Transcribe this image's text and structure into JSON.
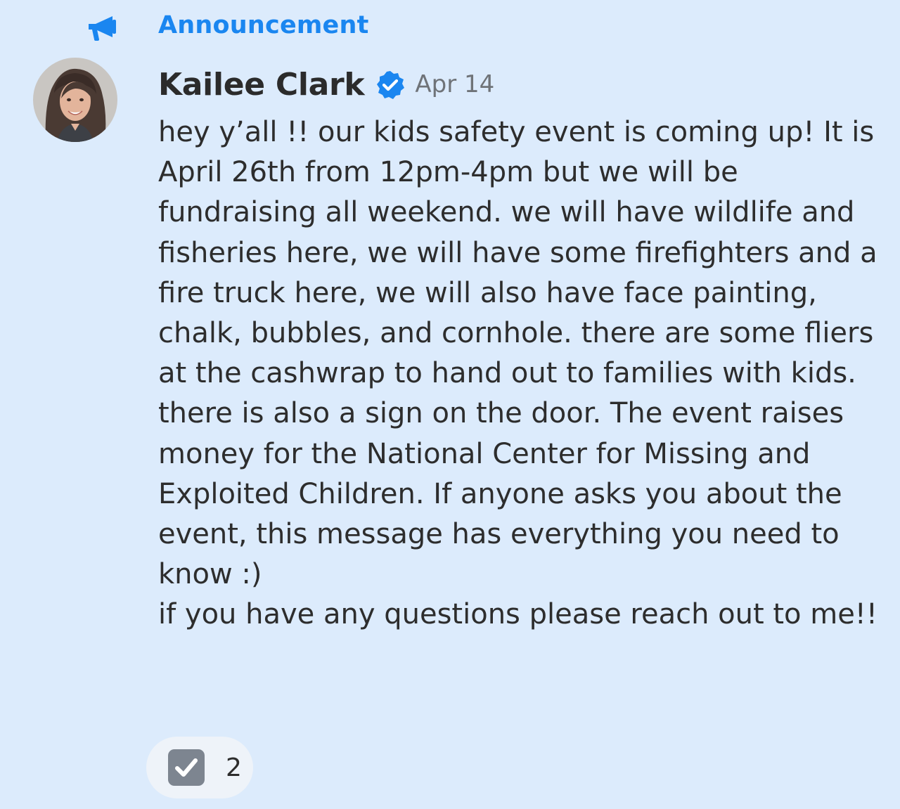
{
  "announcement": {
    "icon": "megaphone-icon",
    "label": "Announcement",
    "color": "#1a86f0"
  },
  "post": {
    "author": "Kailee Clark",
    "verified_icon": "verified-badge-icon",
    "date": "Apr 14",
    "message": "hey y’all !! our kids safety event is coming up! It is April 26th from 12pm-4pm but we will be fundraising all weekend. we will have wildlife and fisheries here, we will have some firefighters and a fire truck here, we will also have face painting, chalk, bubbles, and cornhole. there are some fliers at the cashwrap to hand out to families with kids. there is also a sign on the door. The event raises money for the National Center for Missing and Exploited Children. If anyone asks you about the event, this message has everything you need to know :)\nif you have any questions please reach out to me!!"
  },
  "reactions": [
    {
      "emoji_icon": "check-box-icon",
      "count": "2"
    }
  ],
  "colors": {
    "background": "#dcebfc",
    "accent": "#1a86f0",
    "verified": "#1a86f0"
  }
}
